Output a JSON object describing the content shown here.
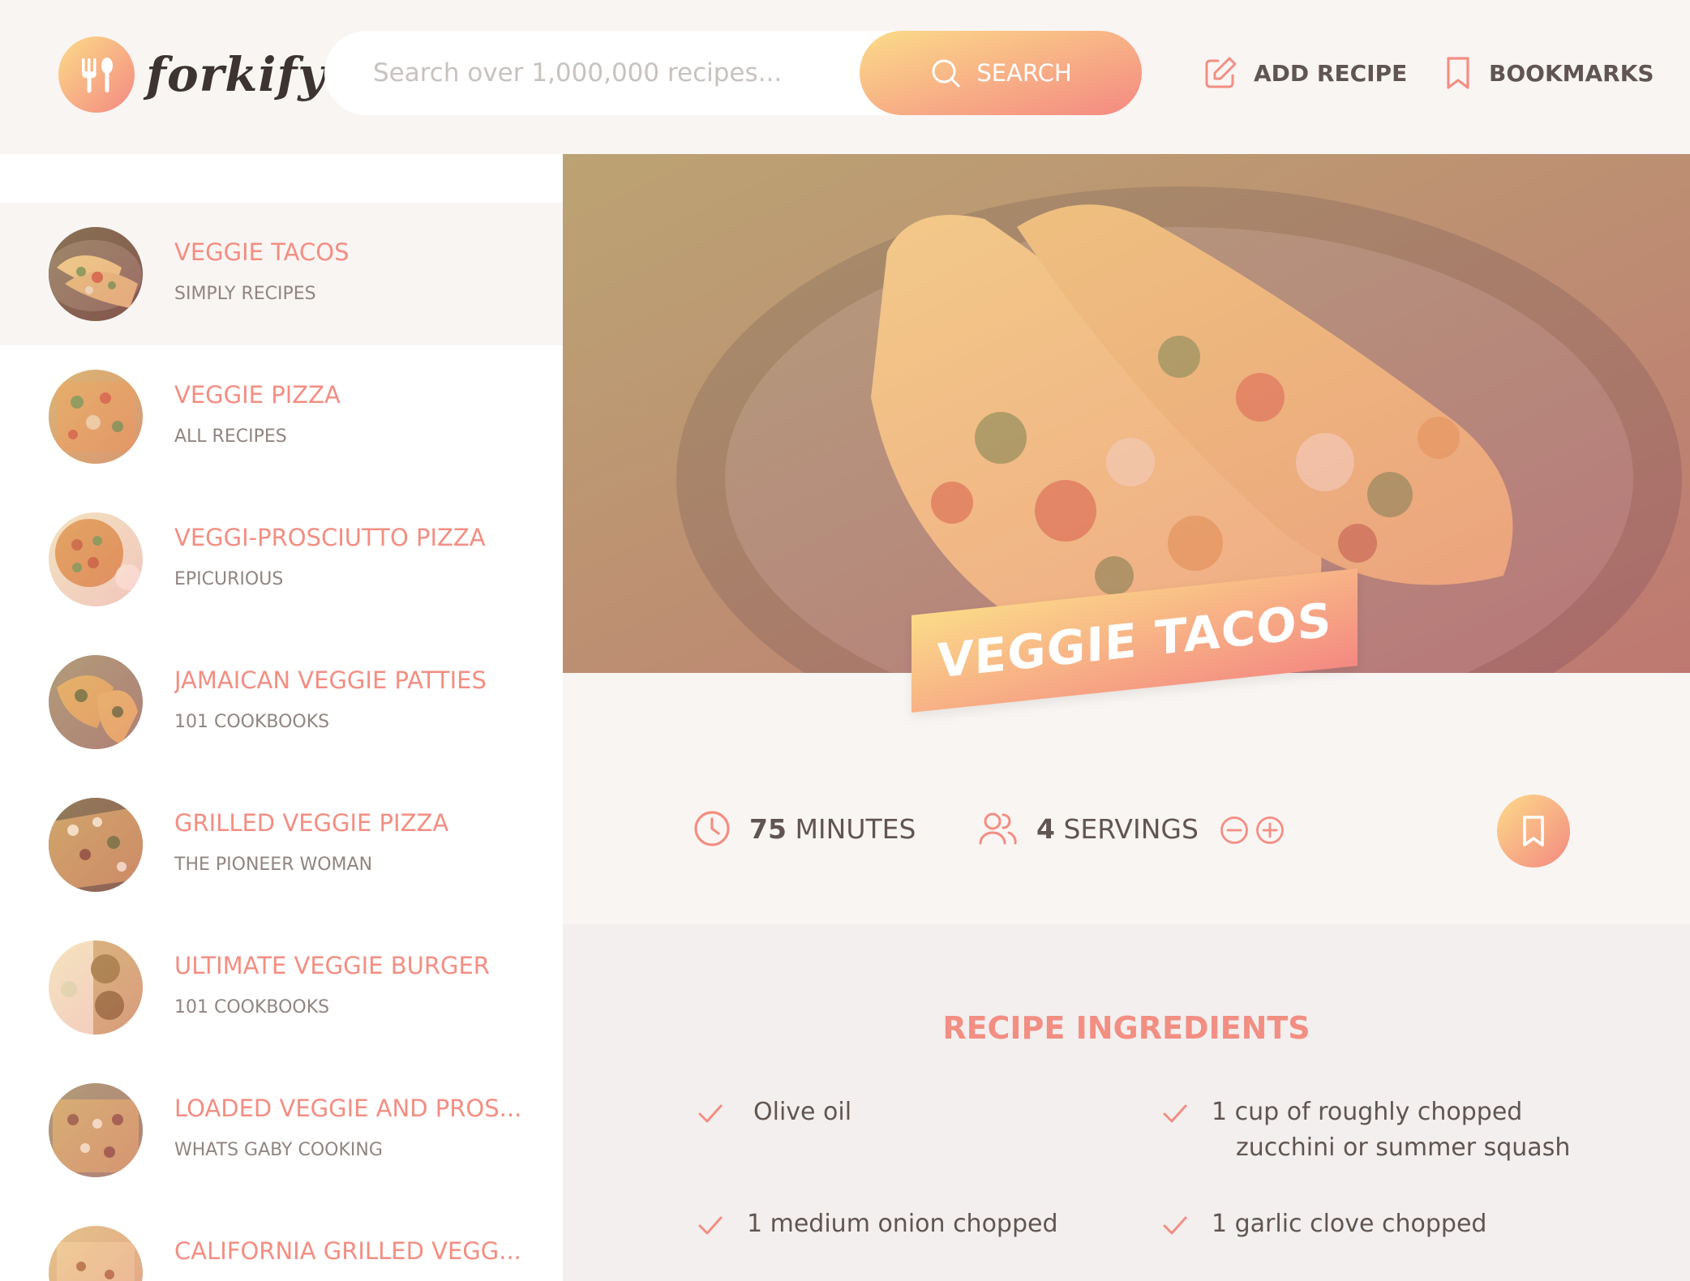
{
  "header": {
    "logo_text": "forkify",
    "search_placeholder": "Search over 1,000,000 recipes...",
    "search_button_label": "SEARCH",
    "add_recipe_label": "ADD RECIPE",
    "bookmarks_label": "BOOKMARKS"
  },
  "results": [
    {
      "title": "VEGGIE TACOS",
      "publisher": "SIMPLY RECIPES"
    },
    {
      "title": "VEGGIE PIZZA",
      "publisher": "ALL RECIPES"
    },
    {
      "title": "VEGGI-PROSCIUTTO PIZZA",
      "publisher": "EPICURIOUS"
    },
    {
      "title": "JAMAICAN VEGGIE PATTIES",
      "publisher": "101 COOKBOOKS"
    },
    {
      "title": "GRILLED VEGGIE PIZZA",
      "publisher": "THE PIONEER WOMAN"
    },
    {
      "title": "ULTIMATE VEGGIE BURGER",
      "publisher": "101 COOKBOOKS"
    },
    {
      "title": "LOADED VEGGIE AND PROS...",
      "publisher": "WHATS GABY COOKING"
    },
    {
      "title": "CALIFORNIA GRILLED VEGG...",
      "publisher": ""
    }
  ],
  "recipe": {
    "title": "VEGGIE TACOS",
    "cooking_time": "75",
    "cooking_time_unit": "MINUTES",
    "servings": "4",
    "servings_unit": "SERVINGS",
    "ingredients_heading": "RECIPE INGREDIENTS",
    "ingredients": [
      {
        "line1": "Olive oil",
        "line2": ""
      },
      {
        "line1": "1 cup of roughly chopped",
        "line2": "zucchini or summer squash"
      },
      {
        "line1": "1 medium onion chopped",
        "line2": ""
      },
      {
        "line1": "1 garlic clove chopped",
        "line2": ""
      }
    ]
  },
  "colors": {
    "accent_light": "#fbdb89",
    "accent_dark": "#f48982",
    "title_color": "#f38e82",
    "text": "#615551"
  }
}
